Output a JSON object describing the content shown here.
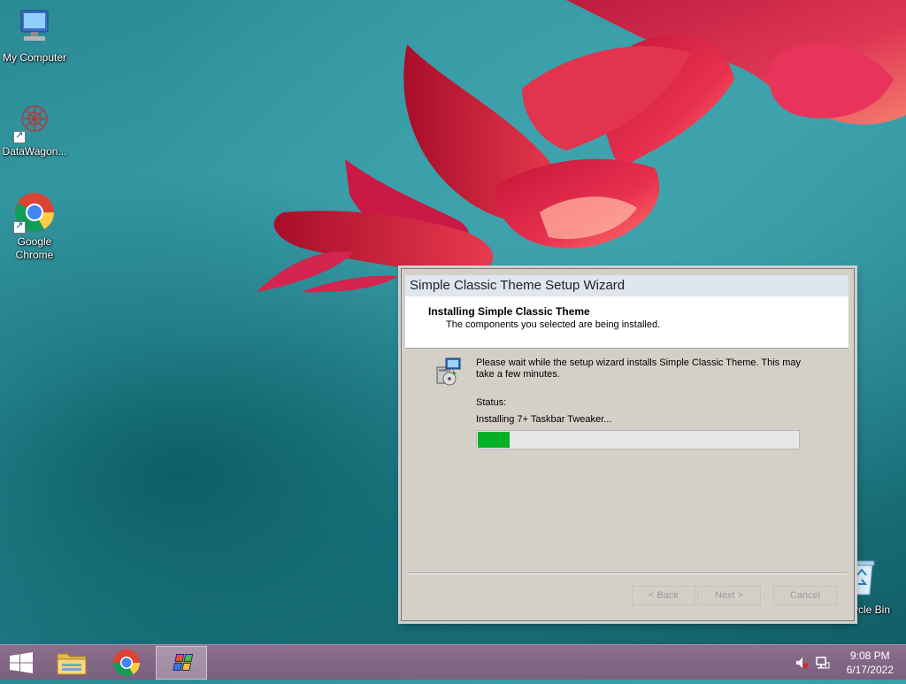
{
  "desktop": {
    "icons": [
      {
        "label": "My Computer"
      },
      {
        "label": "DataWagon..."
      },
      {
        "label": "Google Chrome"
      },
      {
        "label": "ycle Bin"
      }
    ]
  },
  "dialog": {
    "title": "Simple Classic Theme Setup Wizard",
    "header_title": "Installing Simple Classic Theme",
    "header_subtitle": "The components you selected are being installed.",
    "body_text": "Please wait while the setup wizard installs Simple Classic Theme. This may take a few minutes.",
    "status_label": "Status:",
    "status_text": "Installing 7+ Taskbar Tweaker...",
    "progress_fraction": 0.1,
    "buttons": {
      "back": "< Back",
      "next": "Next >",
      "cancel": "Cancel"
    }
  },
  "taskbar": {
    "time": "9:08 PM",
    "date": "6/17/2022"
  },
  "colors": {
    "progress_fill": "#06b025",
    "taskbar": "#7a5f7f"
  }
}
